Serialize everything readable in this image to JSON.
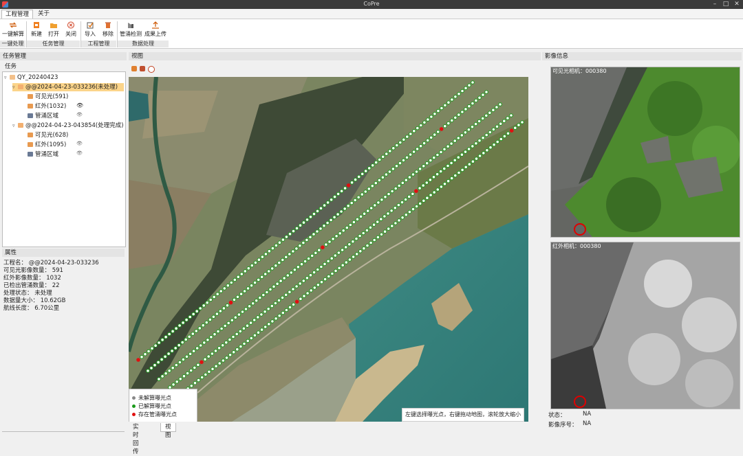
{
  "window": {
    "title": "CoPre"
  },
  "menu": [
    {
      "label": "工程管理"
    },
    {
      "label": "关于"
    }
  ],
  "ribbon": {
    "buttons": [
      {
        "label": "一键解算",
        "icon": "oneclick-solve-icon"
      },
      {
        "label": "新建",
        "icon": "new-task-icon"
      },
      {
        "label": "打开",
        "icon": "open-folder-icon"
      },
      {
        "label": "关闭",
        "icon": "close-circle-icon"
      },
      {
        "label": "导入",
        "icon": "import-icon"
      },
      {
        "label": "移除",
        "icon": "trash-icon"
      },
      {
        "label": "管涌检测",
        "icon": "detect-icon"
      },
      {
        "label": "成果上传",
        "icon": "upload-icon"
      }
    ],
    "groups": [
      {
        "label": "一键处理"
      },
      {
        "label": "任务管理"
      },
      {
        "label": "工程管理"
      },
      {
        "label": "数据处理"
      }
    ]
  },
  "left": {
    "header": "任务管理",
    "task_label": "任务",
    "tree": [
      {
        "label": "QY_20240423"
      },
      {
        "label": "@@2024-04-23-033236(未处理)"
      },
      {
        "label": "可见光(591)"
      },
      {
        "label": "红外(1032)"
      },
      {
        "label": "管涌区域"
      },
      {
        "label": "@@2024-04-23-043854(处理完成)"
      },
      {
        "label": "可见光(628)"
      },
      {
        "label": "红外(1095)"
      },
      {
        "label": "管涌区域"
      }
    ],
    "props_header": "属性",
    "props": [
      {
        "label": "工程名：",
        "value": "@@2024-04-23-033236"
      },
      {
        "label": "可见光影像数量：",
        "value": "591"
      },
      {
        "label": "红外影像数量：",
        "value": "1032"
      },
      {
        "label": "已检出管涌数量：",
        "value": "22"
      },
      {
        "label": "处理状态：",
        "value": "未处理"
      },
      {
        "label": "数据量大小：",
        "value": "10.62GB"
      },
      {
        "label": "航线长度：",
        "value": "6.70公里"
      }
    ]
  },
  "view": {
    "header": "视图",
    "legend": [
      {
        "label": "未解算曝光点",
        "color": "#888888"
      },
      {
        "label": "已解算曝光点",
        "color": "#1a9a1a"
      },
      {
        "label": "存在管涌曝光点",
        "color": "#e01010"
      }
    ],
    "hint": "左键选择曝光点，右键拖动地图，滚轮放大缩小",
    "tabs": [
      {
        "label": "实时回传"
      },
      {
        "label": "视图"
      }
    ]
  },
  "right": {
    "header": "影像信息",
    "visible_caption": "可见光相机：000380",
    "infrared_caption": "红外相机：000380",
    "status_label": "状态：",
    "status_value": "NA",
    "index_label": "影像序号：",
    "index_value": "NA"
  }
}
